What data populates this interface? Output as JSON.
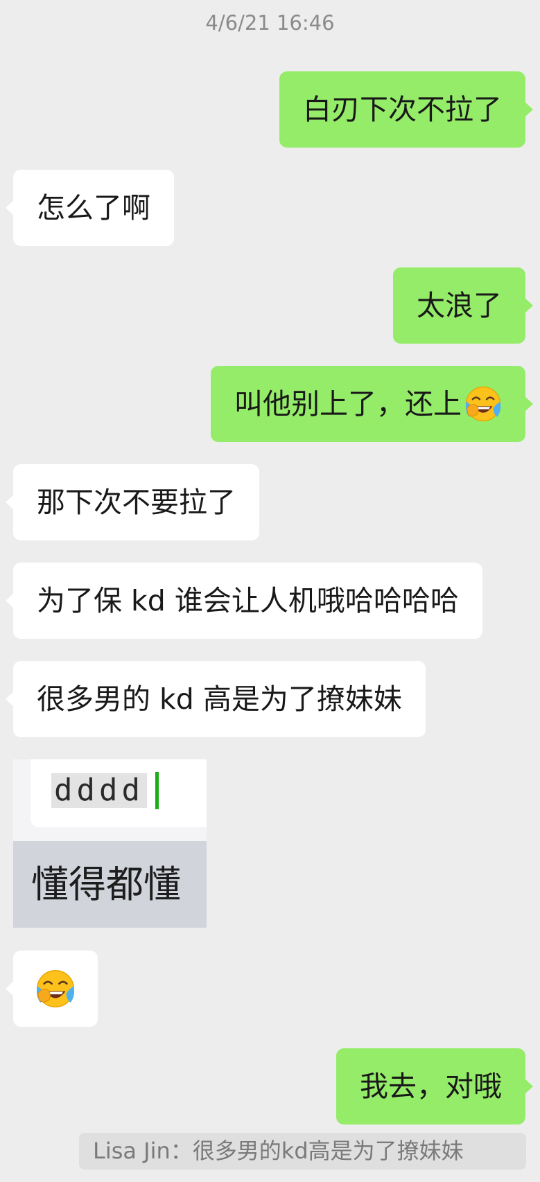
{
  "timestamp": "4/6/21 16:46",
  "messages": [
    {
      "side": "out",
      "text": "白刃下次不拉了"
    },
    {
      "side": "in",
      "text": "怎么了啊"
    },
    {
      "side": "out",
      "text": "太浪了"
    },
    {
      "side": "out",
      "text": "叫他别上了，还上",
      "emoji": "face-with-tears-of-joy"
    },
    {
      "side": "in",
      "text": "那下次不要拉了"
    },
    {
      "side": "in",
      "text": "为了保 kd 谁会让人机哦哈哈哈哈"
    },
    {
      "side": "in",
      "text": "很多男的 kd 高是为了撩妹妹"
    },
    {
      "side": "in",
      "type": "sticker",
      "typed": "dddd",
      "caption": "懂得都懂"
    },
    {
      "side": "in",
      "type": "emoji",
      "emoji": "face-with-tears-of-joy"
    },
    {
      "side": "out",
      "text": "我去，对哦"
    }
  ],
  "quote": "Lisa Jin：很多男的kd高是为了撩妹妹",
  "colors": {
    "background": "#ededed",
    "outgoing_bubble": "#95ec69",
    "incoming_bubble": "#ffffff",
    "quote_background": "#dfdfdf"
  }
}
